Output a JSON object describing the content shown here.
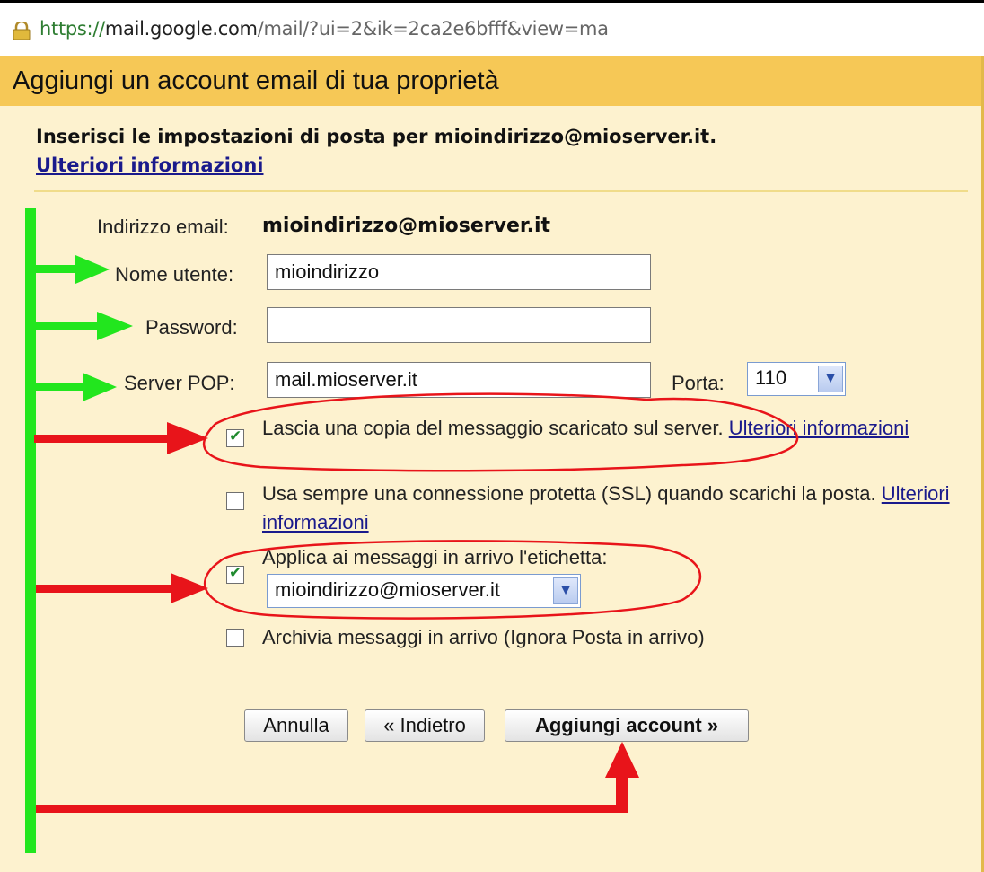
{
  "browser": {
    "url_scheme": "https://",
    "url_host": "mail.google.com",
    "url_path": "/mail/?ui=2&ik=2ca2e6bfff&view=ma"
  },
  "dialog": {
    "title": "Aggiungi un account email di tua proprietà",
    "intro": "Inserisci le impostazioni di posta per mioindirizzo@mioserver.it.",
    "intro_link": "Ulteriori informazioni"
  },
  "form": {
    "email_label": "Indirizzo email:",
    "email_value": "mioindirizzo@mioserver.it",
    "username_label": "Nome utente:",
    "username_value": "mioindirizzo",
    "password_label": "Password:",
    "password_value": "",
    "server_label": "Server POP:",
    "server_value": "mail.mioserver.it",
    "port_label": "Porta:",
    "port_value": "110",
    "options": [
      {
        "text": "Lascia una copia del messaggio scaricato sul server.",
        "link": "Ulteriori informazioni",
        "checked": true
      },
      {
        "text": "Usa sempre una connessione protetta (SSL) quando scarichi la posta.",
        "link": "Ulteriori informazioni",
        "checked": false
      },
      {
        "text": "Applica ai messaggi in arrivo l'etichetta:",
        "checked": true
      },
      {
        "text": "Archivia messaggi in arrivo (Ignora Posta in arrivo)",
        "checked": false
      }
    ],
    "label_select_value": "mioindirizzo@mioserver.it"
  },
  "buttons": {
    "cancel": "Annulla",
    "back": "« Indietro",
    "add": "Aggiungi account »"
  },
  "colors": {
    "title_bar": "#f6c856",
    "panel": "#fdf2cf",
    "annotation_green": "#22e61e",
    "annotation_red": "#e8141a"
  },
  "icons": {
    "lock": "padlock-icon",
    "dropdown": "chevron-down-icon",
    "checkbox": "checkmark-icon"
  }
}
